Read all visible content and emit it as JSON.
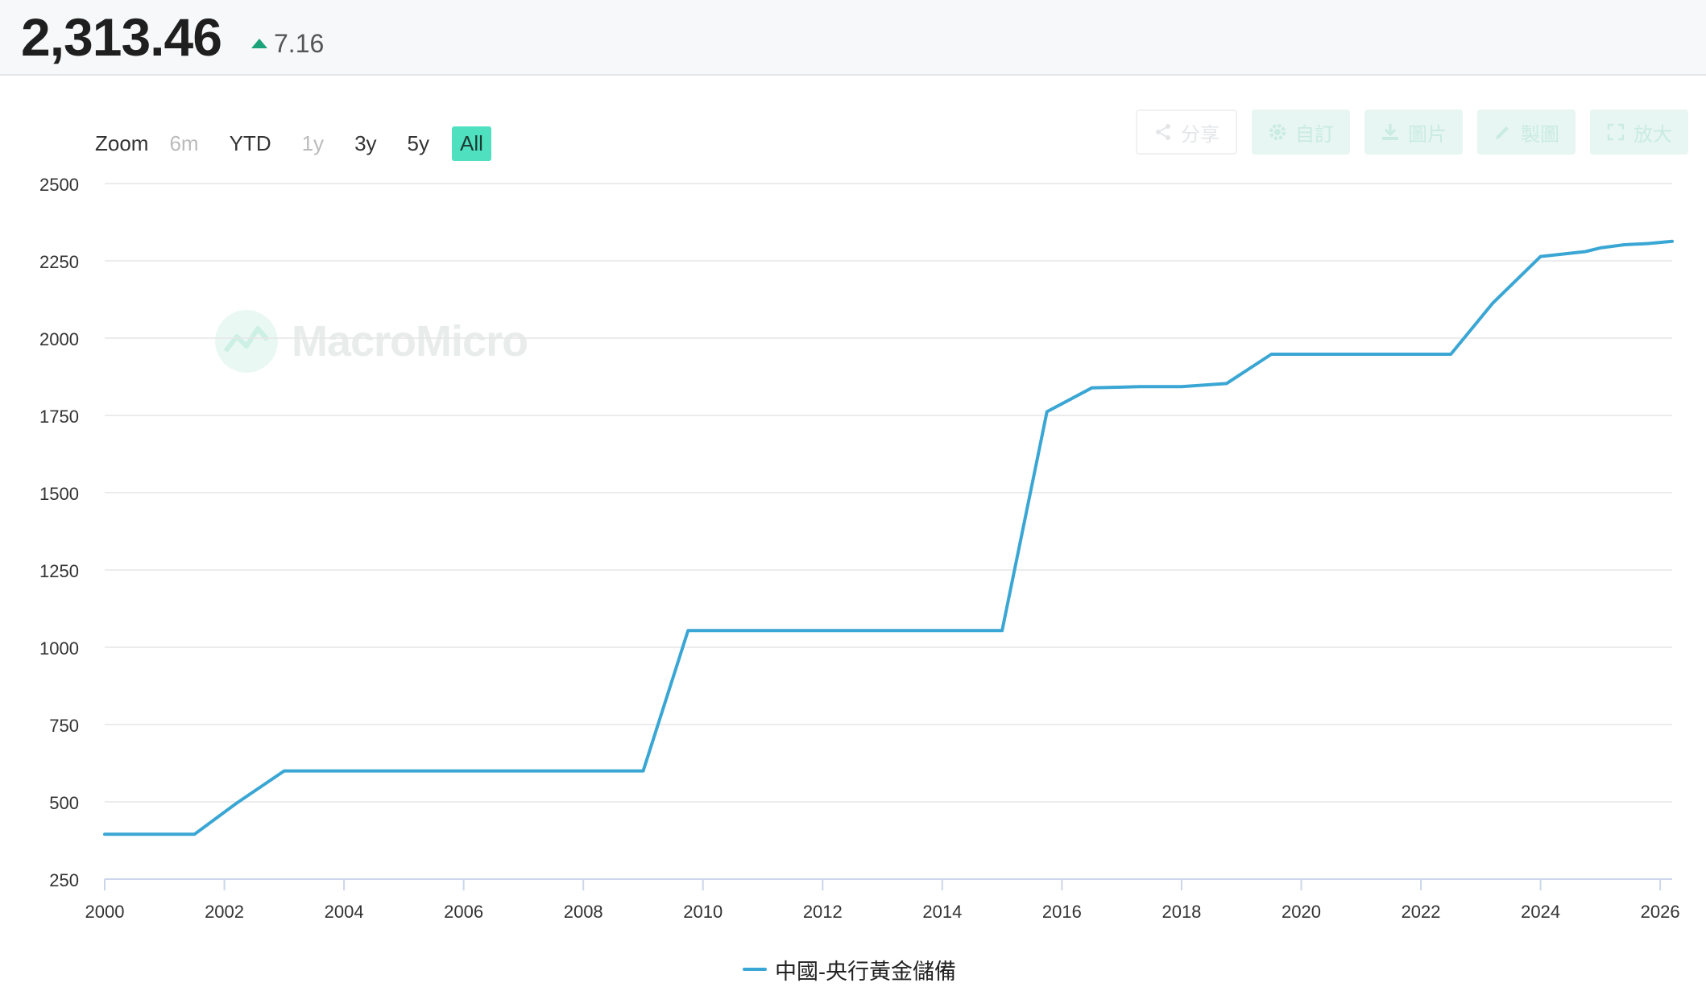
{
  "header": {
    "value": "2,313.46",
    "change": "7.16"
  },
  "zoom": {
    "label": "Zoom",
    "buttons": [
      {
        "label": "6m",
        "state": "disabled"
      },
      {
        "label": "YTD",
        "state": "normal"
      },
      {
        "label": "1y",
        "state": "disabled"
      },
      {
        "label": "3y",
        "state": "normal"
      },
      {
        "label": "5y",
        "state": "normal"
      },
      {
        "label": "All",
        "state": "active"
      }
    ]
  },
  "toolbar": {
    "share": "分享",
    "custom": "自訂",
    "image": "圖片",
    "draw": "製圖",
    "expand": "放大"
  },
  "watermark": {
    "text": "MacroMicro"
  },
  "colors": {
    "series": "#3aa6d4",
    "accent": "#4fe0bf",
    "up": "#1aa37a"
  },
  "chart_data": {
    "type": "line",
    "xlim": [
      2000,
      2026.2
    ],
    "ylim": [
      250,
      2500
    ],
    "yticks": [
      250,
      500,
      750,
      1000,
      1250,
      1500,
      1750,
      2000,
      2250,
      2500
    ],
    "xticks": [
      2000,
      2002,
      2004,
      2006,
      2008,
      2010,
      2012,
      2014,
      2016,
      2018,
      2020,
      2022,
      2024,
      2026
    ],
    "grid": true,
    "legend_position": "bottom-center",
    "series": [
      {
        "name": "中國-央行黃金儲備",
        "x": [
          2000,
          2001.5,
          2002.2,
          2003.0,
          2009.0,
          2009.75,
          2015.0,
          2015.75,
          2016.5,
          2017.3,
          2018.0,
          2018.75,
          2019.5,
          2022.5,
          2023.2,
          2024.0,
          2024.75,
          2025.0,
          2025.4,
          2025.8,
          2026.2
        ],
        "values": [
          395,
          395,
          495,
          600,
          600,
          1054,
          1054,
          1762,
          1839,
          1843,
          1843,
          1853,
          1948,
          1948,
          2113,
          2264,
          2280,
          2292,
          2302,
          2306,
          2313
        ]
      }
    ]
  }
}
